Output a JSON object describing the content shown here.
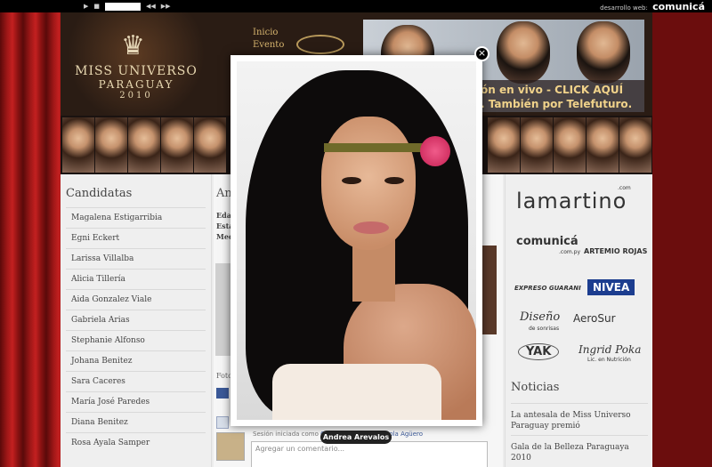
{
  "topbar": {
    "controls": [
      "▶",
      "■",
      "◀◀",
      "▶▶"
    ],
    "credit_label": "desarrollo web:",
    "credit_brand": "comunicá"
  },
  "header": {
    "logo": {
      "line1": "MISS UNIVERSO",
      "line2": "PARAGUAY",
      "line3": "2010"
    },
    "nav": [
      "Inicio",
      "Evento"
    ],
    "banner": {
      "line1": "ón en vivo - CLICK AQUÍ",
      "line2": ". También por Telefuturo."
    }
  },
  "sidebar": {
    "title": "Candidatas",
    "candidates": [
      "Magalena Estigarribia",
      "Egni Eckert",
      "Larissa Villalba",
      "Alicia Tillería",
      "Aida Gonzalez Viale",
      "Gabriela Arias",
      "Stephanie Alfonso",
      "Johana Benitez",
      "Sara Caceres",
      "María José Paredes",
      "Diana Benitez",
      "Rosa Ayala Samper"
    ]
  },
  "main": {
    "heading": "An",
    "meta": [
      "Eda",
      "Esta",
      "Med"
    ],
    "foto_label": "Foto",
    "session_prefix": "Sesión iniciada como",
    "session_user": "Carlos Sebastián Ibarrola Agüero",
    "comment_placeholder": "Agregar un comentario..."
  },
  "sponsors": {
    "lamartino": "lamartino",
    "lamartino_sup": ".com",
    "comunica": "comunicá",
    "comunica_sub": ".com.py",
    "artemio": "ARTEMIO ROJAS",
    "expreso": "EXPRESO GUARANI",
    "nivea": "NIVEA",
    "diseno": "Diseño",
    "diseno_sub": "de sonrisas",
    "aerosur": "AeroSur",
    "yak": "YAK",
    "ingrid": "Ingrid Poka",
    "ingrid_sub": "Lic. en Nutrición"
  },
  "news": {
    "title": "Noticias",
    "items": [
      "La antesala de Miss Universo Paraguay premió",
      "Gala de la Belleza Paraguaya 2010"
    ]
  },
  "lightbox": {
    "close_glyph": "×",
    "caption": "Andrea Arevalos"
  }
}
